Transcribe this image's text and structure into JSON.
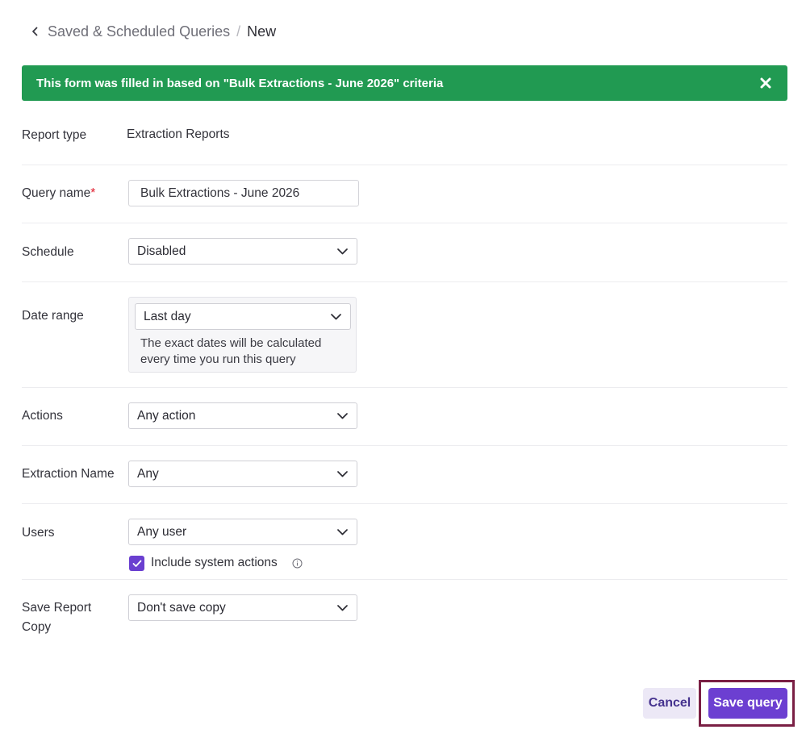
{
  "breadcrumb": {
    "parent": "Saved & Scheduled Queries",
    "separator": "/",
    "current": "New"
  },
  "banner": {
    "text": "This form was filled in based on \"Bulk Extractions - June 2026\" criteria",
    "color": "#219a52"
  },
  "form": {
    "report_type": {
      "label": "Report type",
      "value": "Extraction Reports"
    },
    "query_name": {
      "label": "Query name",
      "required_mark": "*",
      "value": "Bulk Extractions - June 2026"
    },
    "schedule": {
      "label": "Schedule",
      "value": "Disabled"
    },
    "date_range": {
      "label": "Date range",
      "value": "Last day",
      "help": "The exact dates will be calculated every time you run this query"
    },
    "actions": {
      "label": "Actions",
      "value": "Any action"
    },
    "extraction_name": {
      "label": "Extraction Name",
      "value": "Any"
    },
    "users": {
      "label": "Users",
      "value": "Any user",
      "include_system_actions": {
        "label": "Include system actions",
        "checked": true
      }
    },
    "save_report_copy": {
      "label_line1": "Save Report",
      "label_line2": "Copy",
      "value": "Don't save copy"
    }
  },
  "buttons": {
    "cancel": "Cancel",
    "save": "Save query"
  },
  "colors": {
    "accent": "#6c3fd1",
    "success": "#219a52",
    "required": "#e0192a",
    "highlight_frame": "#7a1f44"
  },
  "icons": [
    "chevron-left-icon",
    "close-icon",
    "chevron-down-icon",
    "checkmark-icon",
    "info-icon"
  ]
}
